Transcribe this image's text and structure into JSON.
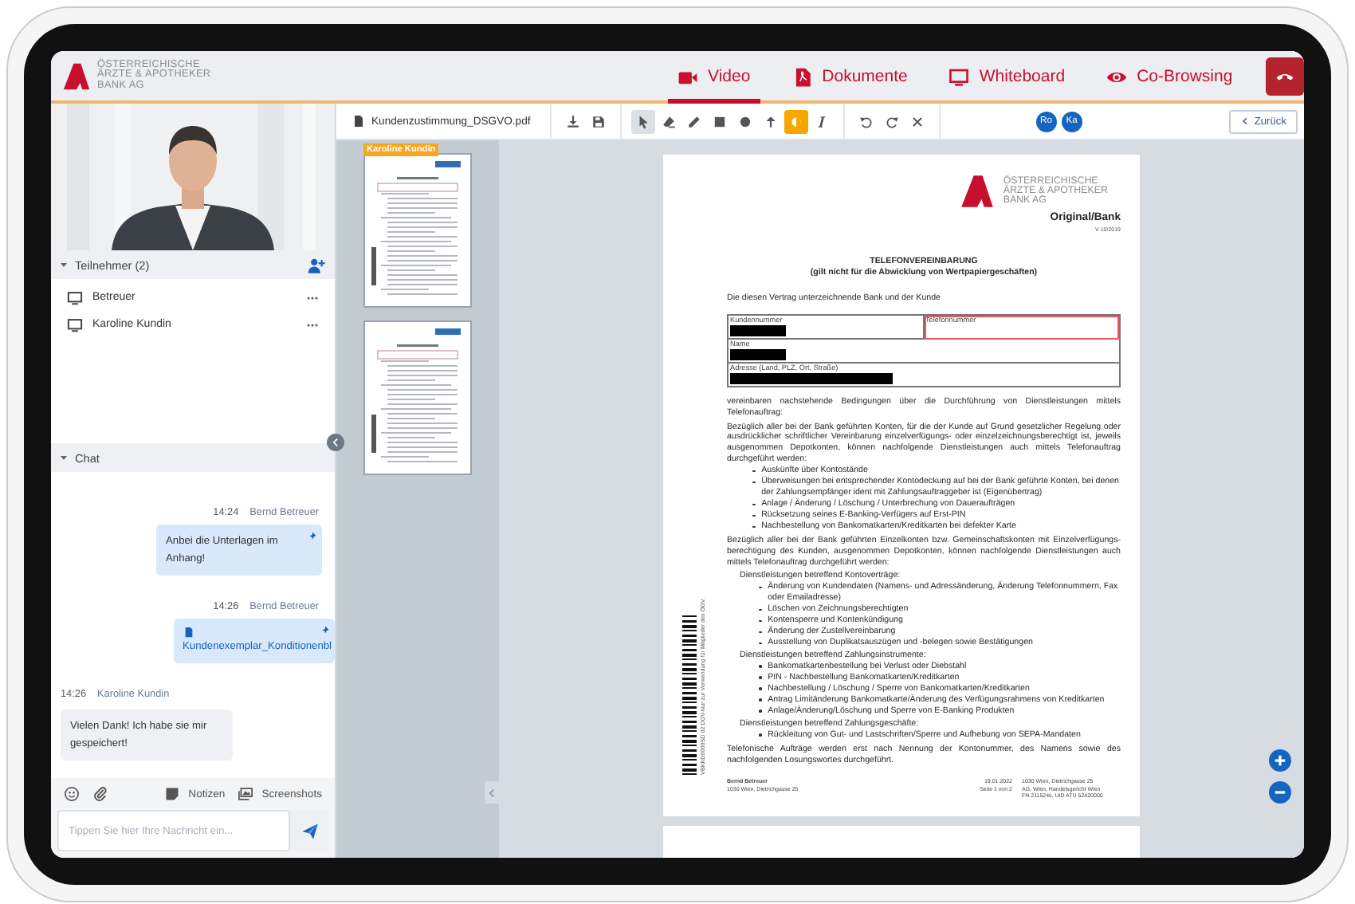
{
  "header": {
    "logo_lines": [
      "ÖSTERREICHISCHE",
      "ÄRZTE & APOTHEKER",
      "BANK AG"
    ],
    "tabs": [
      {
        "kind": "video",
        "label": "Video",
        "selected": true
      },
      {
        "kind": "pdf",
        "label": "Dokumente",
        "selected": false
      },
      {
        "kind": "monitor",
        "label": "Whiteboard",
        "selected": false
      },
      {
        "kind": "eye",
        "label": "Co-Browsing",
        "selected": false
      }
    ]
  },
  "participants": {
    "title": "Teilnehmer (2)",
    "expanded": true,
    "items": [
      {
        "name": "Betreuer"
      },
      {
        "name": "Karoline Kundin"
      }
    ]
  },
  "chat": {
    "title": "Chat",
    "expanded": true,
    "messages": [
      {
        "kind": "sent",
        "time": "14:24",
        "author": "Bernd Betreuer",
        "text": "Anbei die Unterlagen im Anhang!"
      },
      {
        "kind": "file",
        "time": "14:26",
        "author": "Bernd Betreuer",
        "text": "Kundenexemplar_Konditionenbl"
      },
      {
        "kind": "received",
        "time": "14:26",
        "author": "Karoline Kundin",
        "text": "Vielen Dank! Ich habe sie mir gespeichert!"
      }
    ],
    "tools": [
      {
        "kind": "emoji"
      },
      {
        "kind": "attach"
      },
      {
        "kind": "notes",
        "label": "Notizen"
      },
      {
        "kind": "screenshots",
        "label": "Screenshots"
      }
    ],
    "input": {
      "placeholder": "Tippen Sie hier Ihre Nachricht ein..."
    }
  },
  "toolbar": {
    "filename": "Kundenzustimmung_DSGVO.pdf",
    "tool_groups": [
      [
        {
          "kind": "download",
          "selected": false
        },
        {
          "kind": "save",
          "selected": false
        }
      ],
      [
        {
          "kind": "cursor",
          "selected": true
        },
        {
          "kind": "eraser",
          "selected": false
        },
        {
          "kind": "pencil",
          "selected": false
        },
        {
          "kind": "rectangle",
          "selected": false
        },
        {
          "kind": "circle",
          "selected": false
        },
        {
          "kind": "arrow",
          "selected": false
        },
        {
          "kind": "color",
          "selected": false,
          "color": "#f7a600"
        },
        {
          "kind": "text",
          "selected": false
        }
      ],
      [
        {
          "kind": "undo",
          "selected": false
        },
        {
          "kind": "redo",
          "selected": false
        },
        {
          "kind": "clear",
          "selected": false
        }
      ]
    ],
    "avatars": [
      {
        "initials": "Ro"
      },
      {
        "initials": "Ka"
      }
    ],
    "back_button": "Zurück"
  },
  "thumbnails": [
    {
      "kind": "page",
      "label": "Karoline Kundin"
    },
    {
      "kind": "page"
    }
  ],
  "document": {
    "logo_lines": [
      "ÖSTERREICHISCHE",
      "ÄRZTE & APOTHEKER",
      "BANK AG"
    ],
    "copy_label": "Original/Bank",
    "version": "V 10/2019",
    "title": "TELEFONVEREINBARUNG",
    "subtitle": "(gilt nicht für die  Abwicklung von Wertpapiergeschäften)",
    "intro": "Die diesen Vertrag unterzeichnende Bank und der Kunde",
    "fields": [
      {
        "kind": "half",
        "label": "Kundennummer",
        "redacted": true,
        "highlighted": false
      },
      {
        "kind": "half",
        "label": "Telefonnummer",
        "redacted": false,
        "highlighted": true
      },
      {
        "kind": "full",
        "label": "Name",
        "redacted": true,
        "highlighted": false
      },
      {
        "kind": "address",
        "label": "Adresse (Land, PLZ, Ort, Straße)",
        "redacted": true,
        "highlighted": false
      }
    ],
    "blocks": [
      {
        "kind": "paragraph",
        "text": "vereinbaren nachstehende Bedingungen über die Durchführung von Dienstleistungen mittels Telefonauftrag:"
      },
      {
        "kind": "paragraph",
        "text": "Bezüglich aller bei der Bank geführten Konten, für die der Kunde auf Grund gesetzlicher Regelung oder ausdrücklicher schriftlicher Vereinbarung einzelverfügungs- oder einzelzeichnungsberechtigt ist, jeweils ausgenommen Depotkonten, können nachfolgende Dienstleistungen auch mittels Telefonauftrag durchgeführt werden:"
      },
      {
        "kind": "bullets",
        "items": [
          "Auskünfte über Kontostände",
          "Überweisungen bei entsprechender Kontodeckung auf bei der Bank geführte Konten, bei denen der Zahlungsempfänger ident mit Zahlungsauftraggeber ist (Eigenübertrag)",
          "Anlage / Änderung / Löschung / Unterbrechung von Daueraufträgen",
          "Rücksetzung seines E-Banking-Verfügers auf Erst-PIN",
          "Nachbestellung von Bankomatkarten/Kreditkarten bei defekter Karte"
        ]
      },
      {
        "kind": "paragraph",
        "text": "Bezüglich aller bei der Bank geführten Einzelkonten bzw. Gemeinschaftskonten mit Einzelverfügungs-berechtigung des Kunden, ausgenommen Depotkonten, können nachfolgende Dienstleistungen auch mittels Telefonauftrag durchgeführt werden:"
      },
      {
        "kind": "heading",
        "text": "Dienstleistungen betreffend Kontoverträge:"
      },
      {
        "kind": "bullets",
        "items": [
          "Änderung von Kundendaten (Namens- und  Adressänderung, Änderung Telefonnummern, Fax oder Emailadresse)",
          "Löschen von Zeichnungsberechtigten",
          "Kontensperre und Kontenkündigung",
          "Änderung der Zustellvereinbarung",
          "Ausstellung von Duplikatsauszügen und -belegen sowie Bestätigungen"
        ]
      },
      {
        "kind": "heading",
        "text": "Dienstleistungen betreffend Zahlungsinstrumente:"
      },
      {
        "kind": "bullets",
        "items": [
          "Bankomatkartenbestellung bei Verlust oder Diebstahl",
          "PIN - Nachbestellung Bankomatkarten/Kreditkarten",
          "Nachbestellung / Löschung / Sperre von Bankomatkarten/Kreditkarten",
          "Antrag Limitänderung Bankomatkarte/Änderung des Verfügungsrahmens von Kreditkarten",
          "Anlage/Änderung/Löschung und Sperre von E-Banking Produkten"
        ]
      },
      {
        "kind": "heading",
        "text": "Dienstleistungen betreffend Zahlungsgeschäfte:"
      },
      {
        "kind": "bullets",
        "items": [
          "Rückleitung von Gut- und Lastschriften/Sperre und Aufhebung von SEPA-Mandaten"
        ]
      },
      {
        "kind": "paragraph",
        "text": "Telefonische Aufträge werden  erst nach Nennung der Kontonummer, des Namens sowie des nachfolgenden Losungswortes durchgeführt."
      }
    ],
    "barcode_text": "VBKKD0000SD 02 DGV-Nur zur Verwendung für Mitglieder des ÖGV.",
    "footer": {
      "sender_name": "Bernd Betreuer",
      "sender_address": "1030 Wien, Dietrichgasse 25",
      "date": "19.01.2022",
      "page": "Seite  1  von  2",
      "bank_lines": [
        "1030 Wien, Dietrichgasse 25",
        "AG, Wien, Handelsgericht Wien",
        "FN 211524s, UID ATU 52420000"
      ]
    }
  }
}
